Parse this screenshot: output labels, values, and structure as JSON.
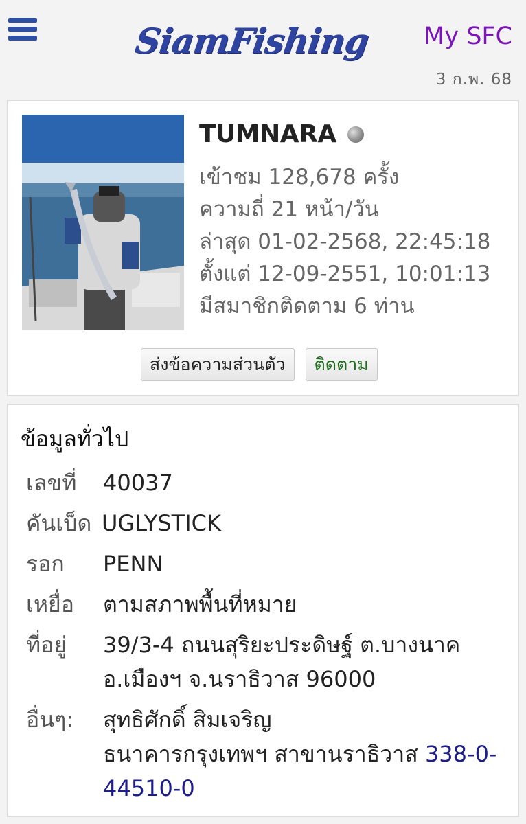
{
  "header": {
    "logo_text": "SiamFishing",
    "my_sfc_label": "My SFC",
    "date": "3 ก.พ. 68"
  },
  "profile": {
    "username": "TUMNARA",
    "views": "เข้าชม 128,678 ครั้ง",
    "frequency": "ความถี่ 21 หน้า/วัน",
    "latest": "ล่าสุด 01-02-2568, 22:45:18",
    "since": "ตั้งแต่ 12-09-2551, 10:01:13",
    "followers": "มีสมาชิกติดตาม 6 ท่าน",
    "message_button": "ส่งข้อความส่วนตัว",
    "follow_button": "ติดตาม"
  },
  "info": {
    "title": "ข้อมูลทั่วไป",
    "rows": [
      {
        "label": "เลขที่",
        "value": "40037"
      },
      {
        "label": "คันเบ็ด",
        "value": "UGLYSTICK"
      },
      {
        "label": "รอก",
        "value": "PENN"
      },
      {
        "label": "เหยื่อ",
        "value": "ตามสภาพพื้นที่หมาย"
      },
      {
        "label": "ที่อยู่",
        "value_line1": "39/3-4 ถนนสุริยะประดิษฐ์ ต.บางนาค",
        "value_line2": "อ.เมืองฯ จ.นราธิวาส 96000"
      },
      {
        "label": "อื่นๆ:",
        "value_line1": "สุทธิศักดิ์ สิมเจริญ",
        "value_line2": "ธนาคารกรุงเทพฯ สาขานราธิวาส",
        "account": "338-0-44510-0"
      }
    ]
  },
  "colors": {
    "logo": "#2e44a0",
    "my_sfc": "#7a16b8",
    "follow": "#1f6b1f",
    "account": "#1d1d8c"
  }
}
